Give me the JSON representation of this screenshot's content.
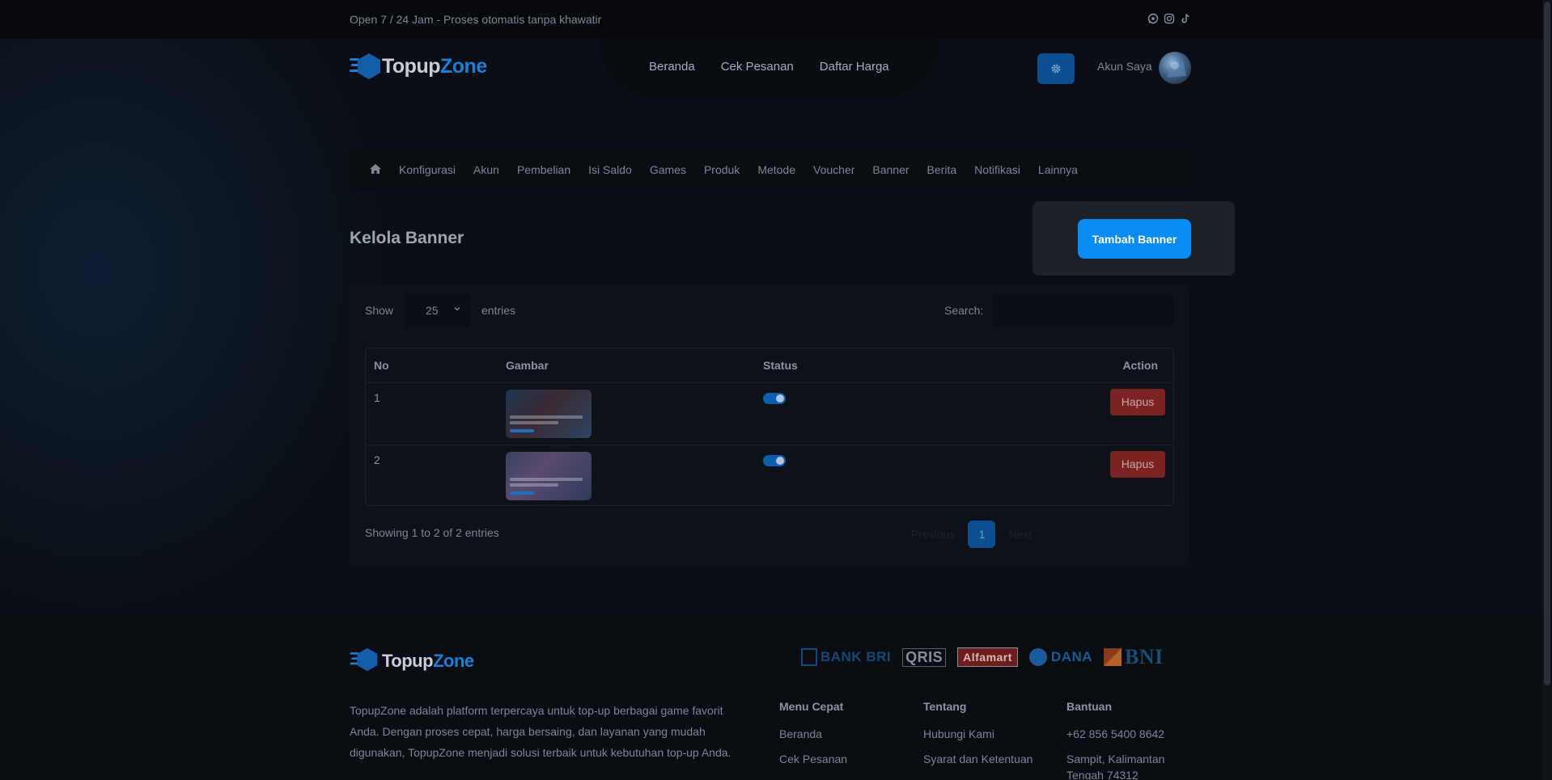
{
  "topbar": {
    "tagline": "Open 7 / 24 Jam - Proses otomatis tanpa khawatir",
    "social_icons": [
      "whatsapp-icon",
      "instagram-icon",
      "tiktok-icon"
    ]
  },
  "header": {
    "logo_part1": "Topup",
    "logo_part2": "Zone",
    "nav": [
      "Beranda",
      "Cek Pesanan",
      "Daftar Harga"
    ],
    "account_label": "Akun Saya"
  },
  "admin_menu": {
    "home_icon": "home-icon",
    "items": [
      "Konfigurasi",
      "Akun",
      "Pembelian",
      "Isi Saldo",
      "Games",
      "Produk",
      "Metode",
      "Voucher",
      "Banner",
      "Berita",
      "Notifikasi",
      "Lainnya"
    ]
  },
  "page": {
    "title": "Kelola Banner",
    "add_button": "Tambah Banner"
  },
  "table": {
    "show_label": "Show",
    "entries_value": "25",
    "entries_label": "entries",
    "search_label": "Search:",
    "search_value": "",
    "columns": [
      "No",
      "Gambar",
      "Status",
      "Action"
    ],
    "rows": [
      {
        "no": "1",
        "status_on": true,
        "action": "Hapus"
      },
      {
        "no": "2",
        "status_on": true,
        "action": "Hapus"
      }
    ],
    "info": "Showing 1 to 2 of 2 entries",
    "pagination": {
      "prev": "Previous",
      "current": "1",
      "next": "Next"
    }
  },
  "footer": {
    "logo_part1": "Topup",
    "logo_part2": "Zone",
    "payments": [
      "BANK BRI",
      "QRIS",
      "Alfamart",
      "DANA",
      "BNI"
    ],
    "description": "TopupZone adalah platform terpercaya untuk top-up berbagai game favorit Anda. Dengan proses cepat, harga bersaing, dan layanan yang mudah digunakan, TopupZone menjadi solusi terbaik untuk kebutuhan top-up Anda.",
    "columns": [
      {
        "title": "Menu Cepat",
        "links": [
          "Beranda",
          "Cek Pesanan"
        ]
      },
      {
        "title": "Tentang",
        "links": [
          "Hubungi Kami",
          "Syarat dan Ketentuan"
        ]
      },
      {
        "title": "Bantuan",
        "links": [
          "+62 856 5400 8642",
          "Sampit, Kalimantan Tengah 74312"
        ]
      }
    ]
  },
  "colors": {
    "accent": "#0b8bf5",
    "danger": "#7a2322",
    "background": "#0b0f15"
  }
}
